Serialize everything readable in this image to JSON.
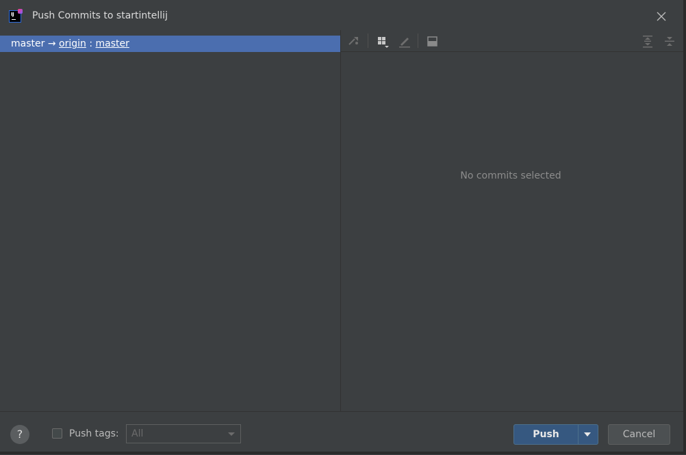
{
  "window": {
    "title": "Push Commits to startintellij",
    "close_icon": "close-icon"
  },
  "branch_tree": {
    "items": [
      {
        "source": "master",
        "arrow": "→",
        "remote": "origin",
        "separator": ":",
        "target": "master",
        "selected": true
      }
    ]
  },
  "commit_details": {
    "empty_text": "No commits selected",
    "toolbar_icons": [
      "cherry-pick-icon",
      "group-by-icon",
      "edit-icon",
      "preview-icon",
      "expand-all-icon",
      "collapse-all-icon"
    ]
  },
  "footer": {
    "help_label": "?",
    "push_tags_label": "Push tags:",
    "push_tags_checked": false,
    "tags_select_value": "All",
    "push_label": "Push",
    "cancel_label": "Cancel"
  },
  "colors": {
    "background": "#3c3f41",
    "selection": "#4b6eaf",
    "primary_button": "#365880"
  }
}
